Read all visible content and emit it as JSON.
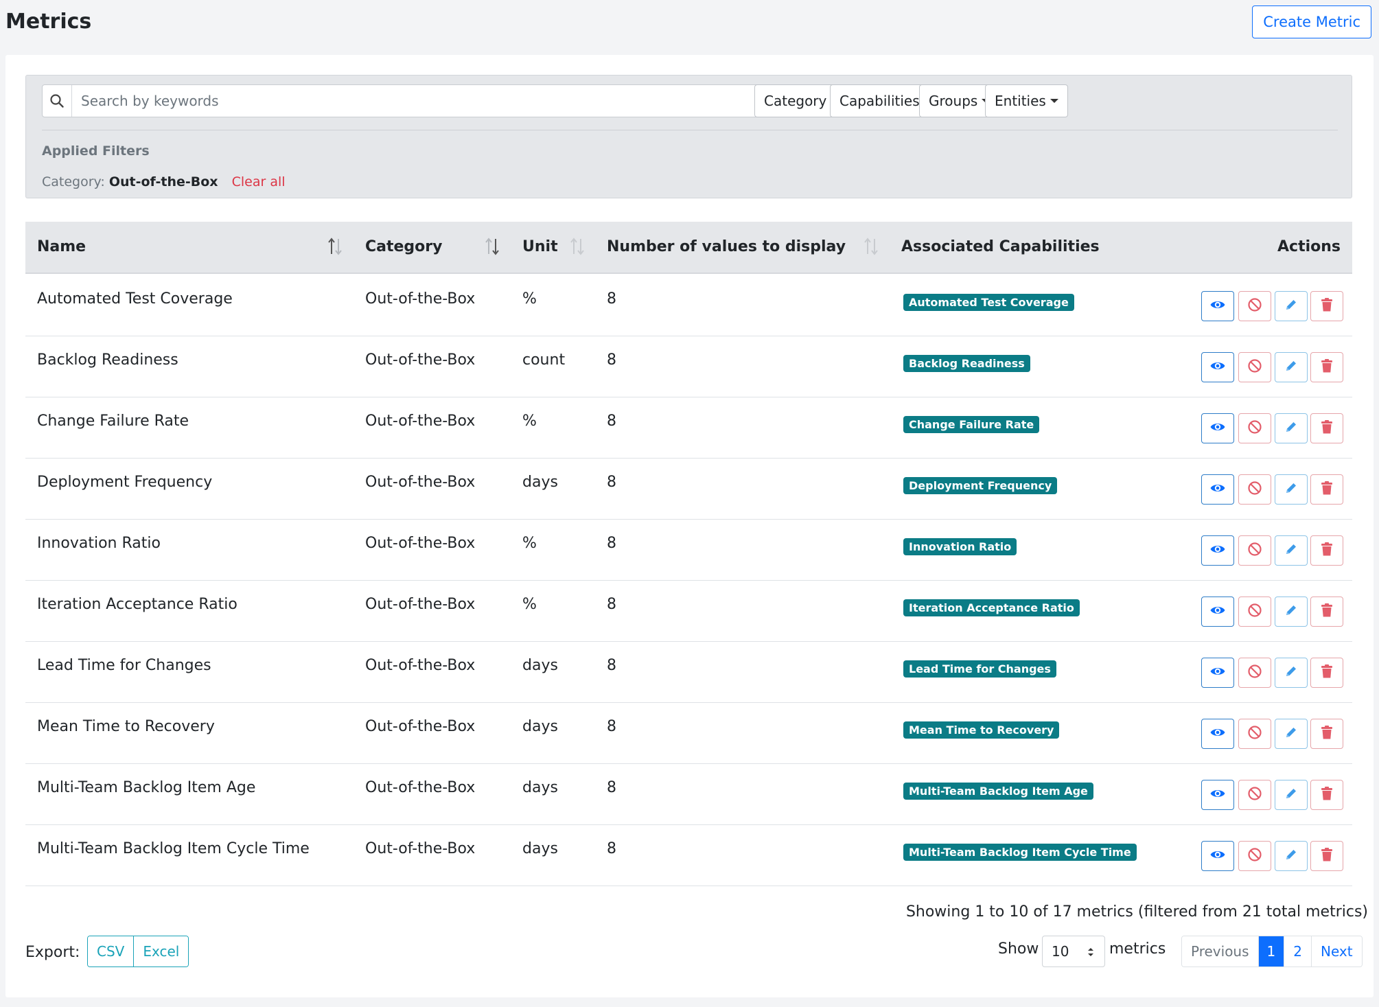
{
  "page": {
    "title": "Metrics",
    "create_button": "Create Metric"
  },
  "filters": {
    "search_placeholder": "Search by keywords",
    "search_value": "",
    "dropdowns": [
      "Category",
      "Capabilities",
      "Groups",
      "Entities"
    ],
    "applied_title": "Applied Filters",
    "applied_label": "Category:",
    "applied_value": "Out-of-the-Box",
    "clear_all": "Clear all"
  },
  "table": {
    "columns": [
      "Name",
      "Category",
      "Unit",
      "Number of values to display",
      "Associated Capabilities",
      "Actions"
    ],
    "rows": [
      {
        "name": "Automated Test Coverage",
        "category": "Out-of-the-Box",
        "unit": "%",
        "values": "8",
        "capability": "Automated Test Coverage"
      },
      {
        "name": "Backlog Readiness",
        "category": "Out-of-the-Box",
        "unit": "count",
        "values": "8",
        "capability": "Backlog Readiness"
      },
      {
        "name": "Change Failure Rate",
        "category": "Out-of-the-Box",
        "unit": "%",
        "values": "8",
        "capability": "Change Failure Rate"
      },
      {
        "name": "Deployment Frequency",
        "category": "Out-of-the-Box",
        "unit": "days",
        "values": "8",
        "capability": "Deployment Frequency"
      },
      {
        "name": "Innovation Ratio",
        "category": "Out-of-the-Box",
        "unit": "%",
        "values": "8",
        "capability": "Innovation Ratio"
      },
      {
        "name": "Iteration Acceptance Ratio",
        "category": "Out-of-the-Box",
        "unit": "%",
        "values": "8",
        "capability": "Iteration Acceptance Ratio"
      },
      {
        "name": "Lead Time for Changes",
        "category": "Out-of-the-Box",
        "unit": "days",
        "values": "8",
        "capability": "Lead Time for Changes"
      },
      {
        "name": "Mean Time to Recovery",
        "category": "Out-of-the-Box",
        "unit": "days",
        "values": "8",
        "capability": "Mean Time to Recovery"
      },
      {
        "name": "Multi-Team Backlog Item Age",
        "category": "Out-of-the-Box",
        "unit": "days",
        "values": "8",
        "capability": "Multi-Team Backlog Item Age"
      },
      {
        "name": "Multi-Team Backlog Item Cycle Time",
        "category": "Out-of-the-Box",
        "unit": "days",
        "values": "8",
        "capability": "Multi-Team Backlog Item Cycle Time"
      }
    ],
    "action_icons": [
      "eye-icon",
      "ban-icon",
      "pencil-icon",
      "trash-icon"
    ]
  },
  "footer": {
    "showing_text": "Showing 1 to 10 of 17 metrics (filtered from 21 total metrics)",
    "export_label": "Export:",
    "export_buttons": [
      "CSV",
      "Excel"
    ],
    "show_label": "Show",
    "page_size": "10",
    "page_size_suffix": "metrics",
    "pagination": [
      "Previous",
      "1",
      "2",
      "Next"
    ],
    "current_page": "1"
  },
  "colors": {
    "primary": "#0d6efd",
    "tag_bg": "#0b7c86",
    "danger": "#dc3545",
    "info": "#1aa3b8",
    "header_bg": "#e5e7ea"
  }
}
